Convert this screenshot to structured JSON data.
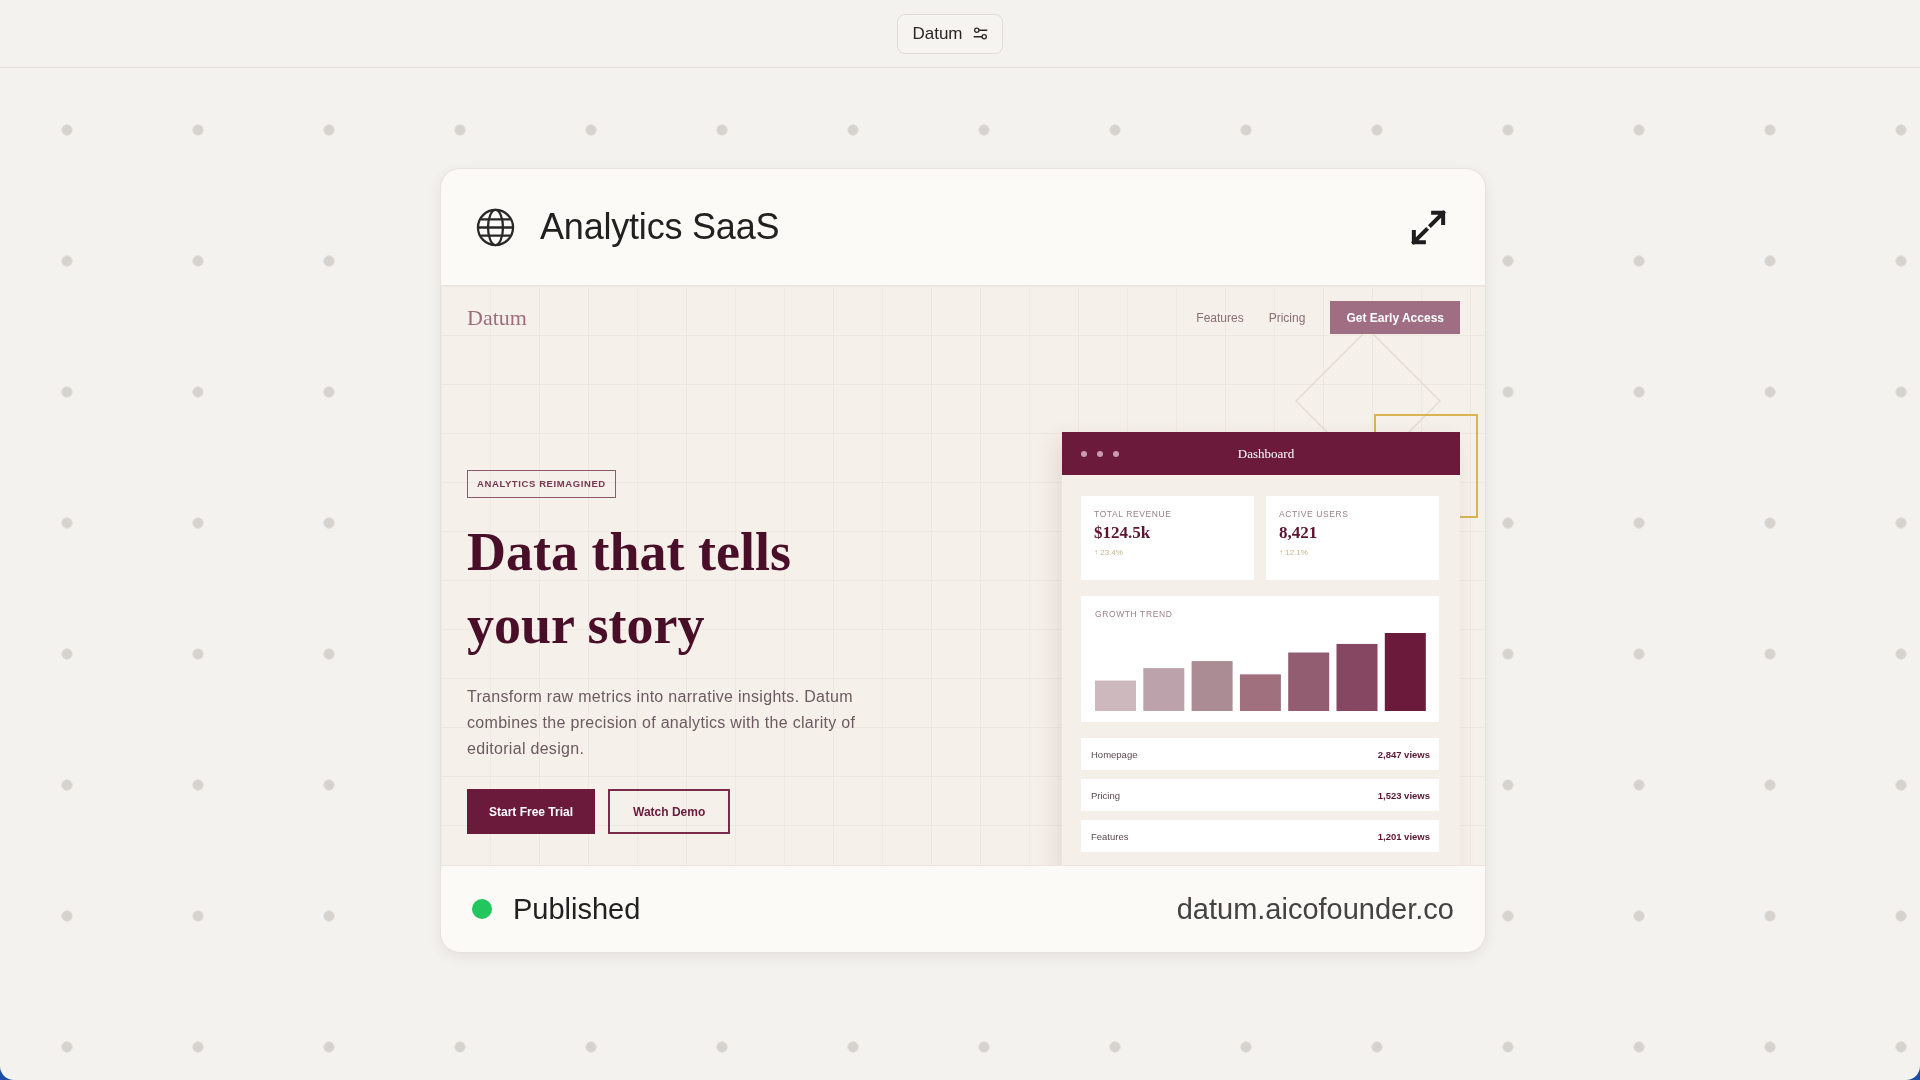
{
  "top_bar": {
    "project_button": "Datum"
  },
  "project_card": {
    "title": "Analytics SaaS",
    "preview": {
      "nav": {
        "logo": "Datum",
        "links": [
          "Features",
          "Pricing"
        ],
        "cta": "Get Early Access"
      },
      "hero": {
        "badge": "ANALYTICS REIMAGINED",
        "heading": "Data that tells your story",
        "description": "Transform raw metrics into narrative insights. Datum combines the precision of analytics with the clarity of editorial design.",
        "buttons": [
          {
            "label": "Start Free Trial",
            "kind": "primary"
          },
          {
            "label": "Watch Demo",
            "kind": "outline"
          }
        ]
      },
      "dashboard": {
        "title": "Dashboard",
        "stats": [
          {
            "label": "TOTAL REVENUE",
            "value": "$124.5k",
            "change": "↑ 23.4%"
          },
          {
            "label": "ACTIVE USERS",
            "value": "8,421",
            "change": "↑ 12.1%"
          }
        ],
        "chart": {
          "title": "GROWTH TREND"
        },
        "pages": [
          {
            "name": "Homepage",
            "views": "2,847 views"
          },
          {
            "name": "Pricing",
            "views": "1,523 views"
          },
          {
            "name": "Features",
            "views": "1,201 views"
          }
        ]
      }
    },
    "status": {
      "label": "Published",
      "color": "#22c55e"
    },
    "url": "datum.aicofounder.co"
  }
}
